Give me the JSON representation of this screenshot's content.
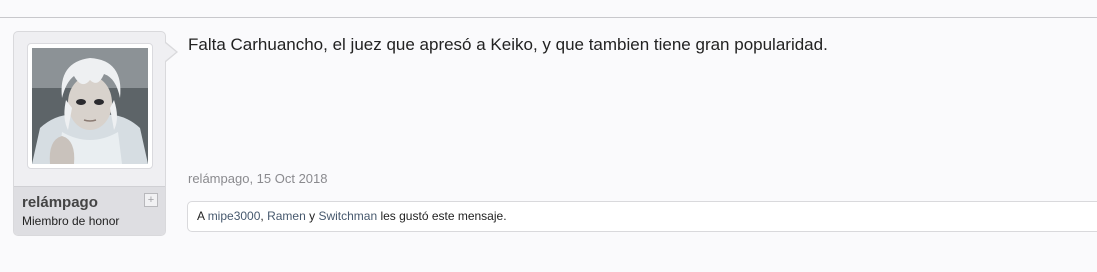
{
  "post": {
    "author": {
      "username": "relámpago",
      "title": "Miembro de honor",
      "expand_symbol": "+",
      "avatar": "anime-character-avatar"
    },
    "message": "Falta Carhuancho, el juez que apresó a Keiko, y que tambien tiene gran popularidad.",
    "meta": {
      "author": "relámpago",
      "separator": ", ",
      "date": "15 Oct 2018"
    },
    "likes": {
      "prefix": "A ",
      "users": [
        "mipe3000",
        "Ramen",
        "Switchman"
      ],
      "sep1": ", ",
      "sep2": " y ",
      "suffix": " les gustó este mensaje."
    }
  },
  "colors": {
    "background": "#fafafc",
    "panel": "#efeff2",
    "link": "#47596e",
    "meta": "#8a8a8e"
  }
}
